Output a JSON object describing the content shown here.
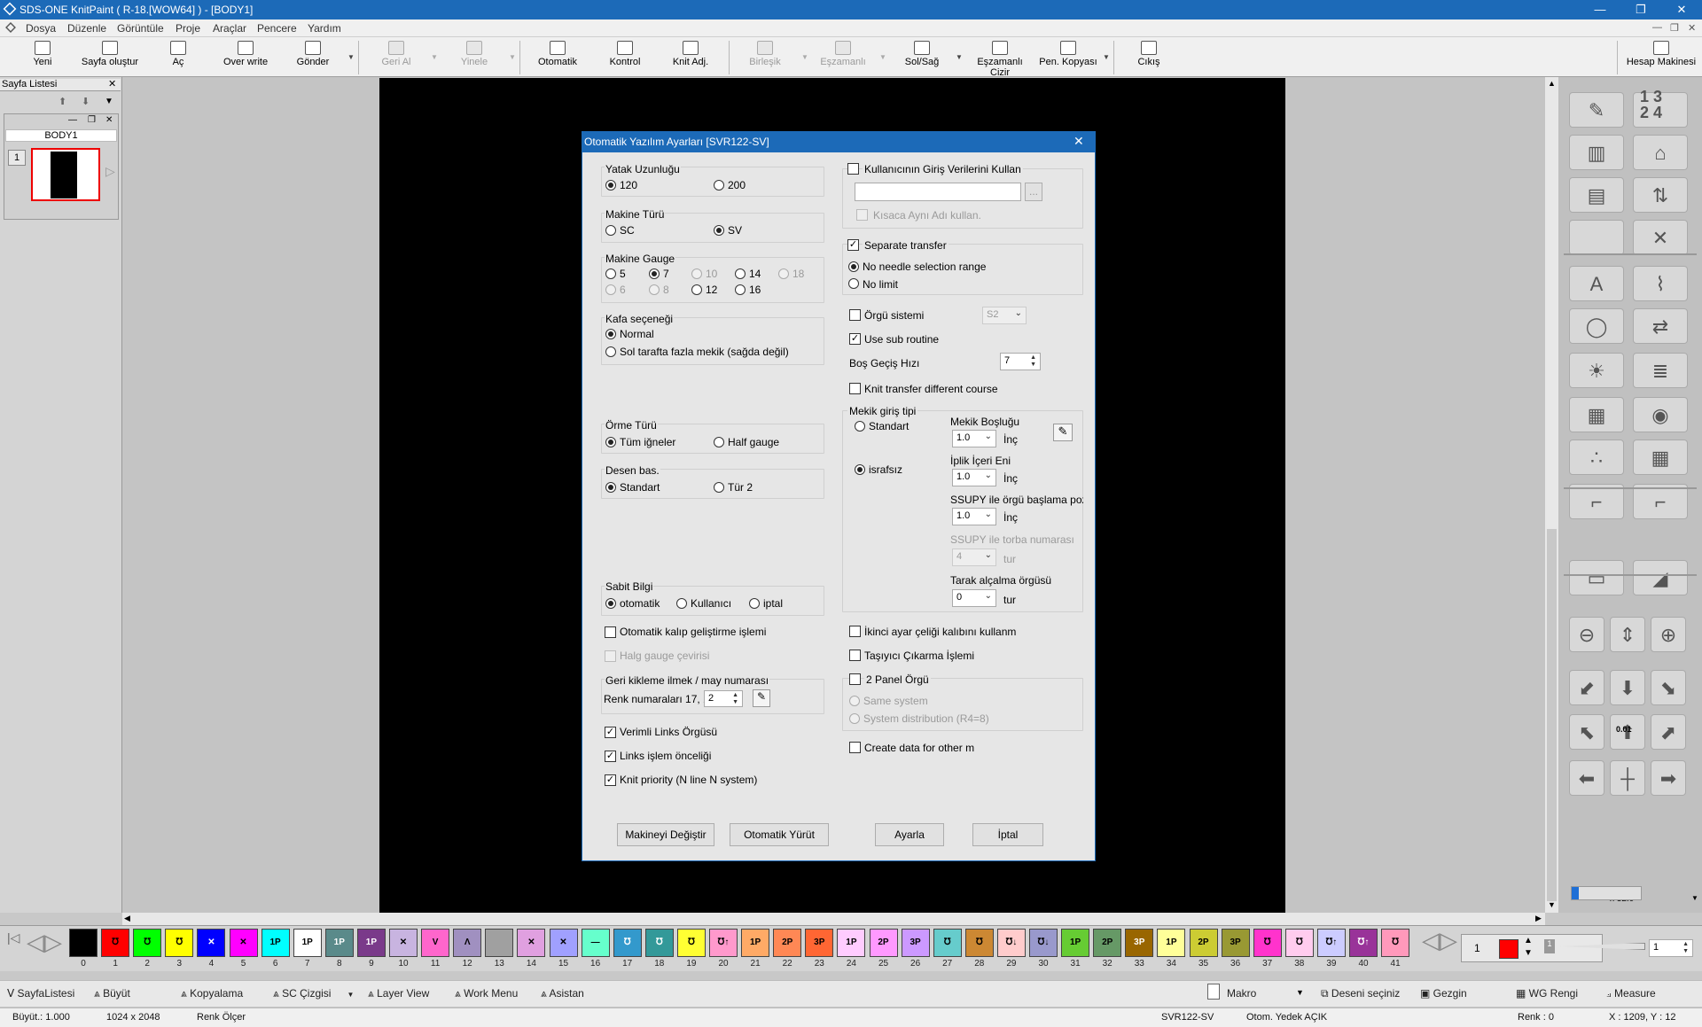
{
  "window": {
    "title": "SDS-ONE KnitPaint ( R-18.[WOW64] ) - [BODY1]",
    "minimize": "—",
    "restore": "❐",
    "close": "✕"
  },
  "menu": [
    "Dosya",
    "Düzenle",
    "Görüntüle",
    "Proje",
    "Araçlar",
    "Pencere",
    "Yardım"
  ],
  "toolbar": {
    "new": "Yeni",
    "create_page": "Sayfa oluştur",
    "open": "Aç",
    "overwrite": "Over write",
    "send": "Gönder",
    "undo": "Geri Al",
    "redo": "Yinele",
    "auto": "Otomatik",
    "control": "Kontrol",
    "knit_adj": "Knit Adj.",
    "merge": "Birleşik",
    "sync": "Eşzamanlı",
    "left_right": "Sol/Sağ",
    "sync_draw": "Eşzamanlı Cizir",
    "pen_copy": "Pen. Kopyası",
    "exit": "Cıkış",
    "calculator": "Hesap Makinesi"
  },
  "left_panel": {
    "title": "Sayfa Listesi",
    "tab": "BODY1",
    "page_number": "1"
  },
  "dialog": {
    "title": "Otomatik Yazılım Ayarları [SVR122-SV]",
    "bed_length": {
      "label": "Yatak Uzunluğu",
      "opt1": "120",
      "opt2": "200"
    },
    "machine_type": {
      "label": "Makine Türü",
      "opt1": "SC",
      "opt2": "SV"
    },
    "gauge": {
      "label": "Makine Gauge",
      "options": [
        "5",
        "7",
        "10",
        "14",
        "18",
        "6",
        "8",
        "12",
        "16"
      ]
    },
    "head": {
      "label": "Kafa seçeneği",
      "opt1": "Normal",
      "opt2": "Sol tarafta fazla mekik (sağda değil)"
    },
    "knit_type": {
      "label": "Örme Türü",
      "opt1": "Tüm iğneler",
      "opt2": "Half gauge"
    },
    "pattern_start": {
      "label": "Desen bas.",
      "opt1": "Standart",
      "opt2": "Tür 2"
    },
    "fixed_info": {
      "label": "Sabit Bilgi",
      "opt1": "otomatik",
      "opt2": "Kullanıcı",
      "opt3": "iptal"
    },
    "auto_mold": "Otomatik kalıp geliştirme işlemi",
    "half_gauge_conv": "Halg gauge çevirisi",
    "back_knit": {
      "label": "Geri kikleme ilmek / may numarası",
      "color_label": "Renk numaraları 17, 1",
      "value": "2"
    },
    "efficient_links": "Verimli Links Örgüsü",
    "links_priority": "Links işlem önceliği",
    "knit_priority": "Knit priority (N line N system)",
    "use_user_input": "Kullanıcının Giriş Verilerini Kullan",
    "browse": "...",
    "short_name": "Kısaca Aynı Adı kullan.",
    "separate_transfer": "Separate transfer",
    "no_needle_range": "No needle selection range",
    "no_limit": "No limit",
    "knit_system": {
      "label": "Örgü sistemi",
      "value": "S2"
    },
    "use_sub_routine": "Use sub routine",
    "idle_speed": {
      "label": "Boş Geçiş Hızı",
      "value": "7"
    },
    "knit_transfer_diff": "Knit transfer different course",
    "carrier_in": {
      "label": "Mekik giriş tipi",
      "standart": "Standart",
      "israfsiz": "israfsız",
      "gap_label": "Mekik Boşluğu",
      "gap_value": "1.0",
      "unit": "İnç",
      "yarn_width_label": "İplik İçeri Eni",
      "yarn_width_value": "1.0",
      "ssupy_start_label": "SSUPY ile örgü başlama pozi:",
      "ssupy_start_value": "1.0",
      "ssupy_bag_label": "SSUPY ile torba numarası",
      "ssupy_bag_value": "4",
      "tur": "tur",
      "comb_label": "Tarak alçalma örgüsü",
      "comb_value": "0"
    },
    "second_adjust": "İkinci ayar çeliği kalıbını kullanm",
    "carrier_remove": "Taşıyıcı Çıkarma İşlemi",
    "two_panel": "2 Panel Örgü",
    "same_system": "Same system",
    "system_dist": "System distribution (R4=8)",
    "create_data": "Create data for other m",
    "btn_change_machine": "Makineyi Değiştir",
    "btn_auto_run": "Otomatik Yürüt",
    "btn_adjust": "Ayarla",
    "btn_cancel": "İptal",
    "close": "✕"
  },
  "palette": [
    {
      "n": "0",
      "c": "#000000",
      "t": ""
    },
    {
      "n": "1",
      "c": "#ff0000",
      "t": "℧"
    },
    {
      "n": "2",
      "c": "#00ff00",
      "t": "℧"
    },
    {
      "n": "3",
      "c": "#ffff00",
      "t": "℧"
    },
    {
      "n": "4",
      "c": "#0000ff",
      "t": "✕"
    },
    {
      "n": "5",
      "c": "#ff00ff",
      "t": "✕"
    },
    {
      "n": "6",
      "c": "#00ffff",
      "t": "1P"
    },
    {
      "n": "7",
      "c": "#ffffff",
      "t": "1P"
    },
    {
      "n": "8",
      "c": "#5a8a8a",
      "t": "1P"
    },
    {
      "n": "9",
      "c": "#7a3a8a",
      "t": "1P"
    },
    {
      "n": "10",
      "c": "#c8b4e0",
      "t": "✕"
    },
    {
      "n": "11",
      "c": "#ff66cc",
      "t": "V"
    },
    {
      "n": "12",
      "c": "#a090c0",
      "t": "Λ"
    },
    {
      "n": "13",
      "c": "#a0a0a0",
      "t": ""
    },
    {
      "n": "14",
      "c": "#e0a0e0",
      "t": "✕"
    },
    {
      "n": "15",
      "c": "#a0a0ff",
      "t": "✕"
    },
    {
      "n": "16",
      "c": "#66ffcc",
      "t": "—"
    },
    {
      "n": "17",
      "c": "#3399cc",
      "t": "℧"
    },
    {
      "n": "18",
      "c": "#339999",
      "t": "℧"
    },
    {
      "n": "19",
      "c": "#ffff33",
      "t": "℧"
    },
    {
      "n": "20",
      "c": "#ff99cc",
      "t": "℧↑"
    },
    {
      "n": "21",
      "c": "#ffaa66",
      "t": "1P"
    },
    {
      "n": "22",
      "c": "#ff8855",
      "t": "2P"
    },
    {
      "n": "23",
      "c": "#ff6633",
      "t": "3P"
    },
    {
      "n": "24",
      "c": "#ffccff",
      "t": "1P"
    },
    {
      "n": "25",
      "c": "#ff99ff",
      "t": "2P"
    },
    {
      "n": "26",
      "c": "#cc99ff",
      "t": "3P"
    },
    {
      "n": "27",
      "c": "#66cccc",
      "t": "℧"
    },
    {
      "n": "28",
      "c": "#cc8833",
      "t": "℧"
    },
    {
      "n": "29",
      "c": "#ffcccc",
      "t": "℧↓"
    },
    {
      "n": "30",
      "c": "#9999cc",
      "t": "℧↓"
    },
    {
      "n": "31",
      "c": "#66cc33",
      "t": "1P"
    },
    {
      "n": "32",
      "c": "#669966",
      "t": "2P"
    },
    {
      "n": "33",
      "c": "#996600",
      "t": "3P"
    },
    {
      "n": "34",
      "c": "#ffff99",
      "t": "1P"
    },
    {
      "n": "35",
      "c": "#cccc33",
      "t": "2P"
    },
    {
      "n": "36",
      "c": "#999933",
      "t": "3P"
    },
    {
      "n": "37",
      "c": "#ff33cc",
      "t": "℧"
    },
    {
      "n": "38",
      "c": "#ffccee",
      "t": "℧"
    },
    {
      "n": "39",
      "c": "#ccccff",
      "t": "℧↑"
    },
    {
      "n": "40",
      "c": "#993399",
      "t": "℧↑"
    },
    {
      "n": "41",
      "c": "#ff99bb",
      "t": "℧"
    }
  ],
  "palette_extra": {
    "current_number": "1",
    "current_color": "#ff0000",
    "spin_value": "1"
  },
  "zoom_label": "x 32.0",
  "move_step": "0.01",
  "bottom_bar": {
    "items": [
      "SayfaListesi",
      "Büyüt",
      "Kopyalama",
      "SC Çizgisi",
      "Layer View",
      "Work Menu",
      "Asistan"
    ],
    "macro": "Makro",
    "select_pattern": "Deseni seçiniz",
    "gezgin": "Gezgin",
    "wg_color": "WG Rengi",
    "measure": "Measure"
  },
  "status": {
    "zoom": "Büyüt.: 1.000",
    "size": "1024 x 2048",
    "ruler": "Renk Ölçer",
    "machine": "SVR122-SV",
    "backup": "Otom. Yedek AÇIK",
    "color": "Renk : 0",
    "coords": "X : 1209, Y : 12"
  }
}
